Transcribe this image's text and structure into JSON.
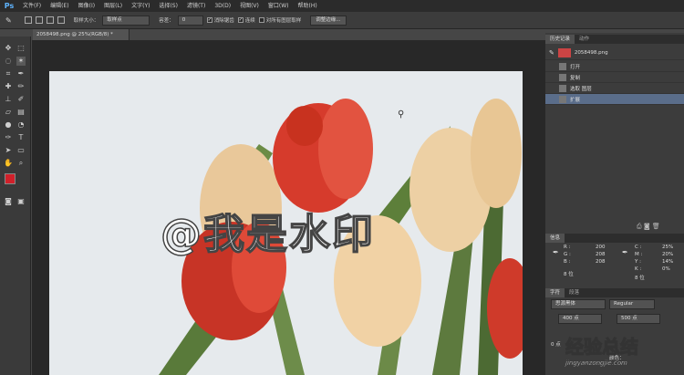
{
  "app": {
    "logo": "Ps"
  },
  "menu": [
    "文件(F)",
    "编辑(E)",
    "图像(I)",
    "图层(L)",
    "文字(Y)",
    "选择(S)",
    "滤镜(T)",
    "3D(D)",
    "视图(V)",
    "窗口(W)",
    "帮助(H)"
  ],
  "options": {
    "size_label": "取样大小：",
    "size_value": "取样点",
    "tolerance_label": "容差：",
    "tolerance_value": "0",
    "anti_alias": "消除锯齿",
    "contiguous": "连续",
    "all_layers": "对所有图层取样",
    "refine_btn": "调整边缘..."
  },
  "document": {
    "tab": "2058498.png @ 25%(RGB/8) *"
  },
  "watermark": "@我是水印",
  "panels": {
    "history": {
      "tabs": [
        "历史记录",
        "动作"
      ],
      "snapshot": "2058498.png",
      "items": [
        "打开",
        "复制",
        "选取 图层",
        "扩展"
      ]
    },
    "info": {
      "tab": "信息",
      "r_label": "R :",
      "g_label": "G :",
      "b_label": "B :",
      "r": "200",
      "g": "208",
      "b": "208",
      "bit_left": "8 位",
      "c_label": "C :",
      "m_label": "M :",
      "y_label": "Y :",
      "k_label": "K :",
      "c": "25%",
      "m": "20%",
      "y": "14%",
      "k": "0%",
      "bit_right": "8 位"
    },
    "character": {
      "tabs": [
        "字符",
        "段落"
      ],
      "font": "思源黑体",
      "style": "Regular",
      "size": "400 点",
      "leading": "500 点",
      "tracking": "0 点",
      "color_label": "颜色："
    }
  },
  "site_watermark": {
    "title": "经验总结",
    "url": "jingyanzongjie.com"
  },
  "colors": {
    "fg": "#d0202a",
    "bg": "#ffffff"
  }
}
